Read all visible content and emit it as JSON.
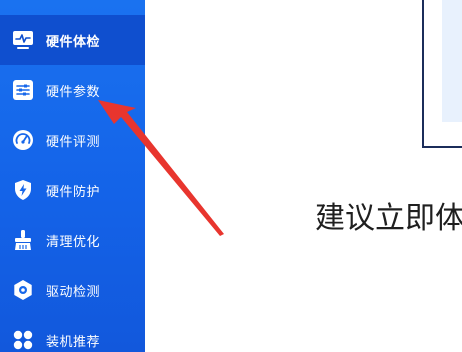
{
  "sidebar": {
    "items": [
      {
        "label": "硬件体检",
        "icon": "monitor-icon",
        "active": true
      },
      {
        "label": "硬件参数",
        "icon": "sliders-icon",
        "active": false
      },
      {
        "label": "硬件评测",
        "icon": "speedometer-icon",
        "active": false
      },
      {
        "label": "硬件防护",
        "icon": "lightning-shield-icon",
        "active": false
      },
      {
        "label": "清理优化",
        "icon": "broom-icon",
        "active": false
      },
      {
        "label": "驱动检测",
        "icon": "gear-icon",
        "active": false
      },
      {
        "label": "装机推荐",
        "icon": "app-grid-icon",
        "active": false
      }
    ]
  },
  "main": {
    "headline": "建议立即体"
  },
  "colors": {
    "sidebar_top": "#1a72f0",
    "sidebar_bottom": "#1258dc",
    "active_item": "#0f4fcf",
    "annotation_arrow": "#e8352e"
  }
}
